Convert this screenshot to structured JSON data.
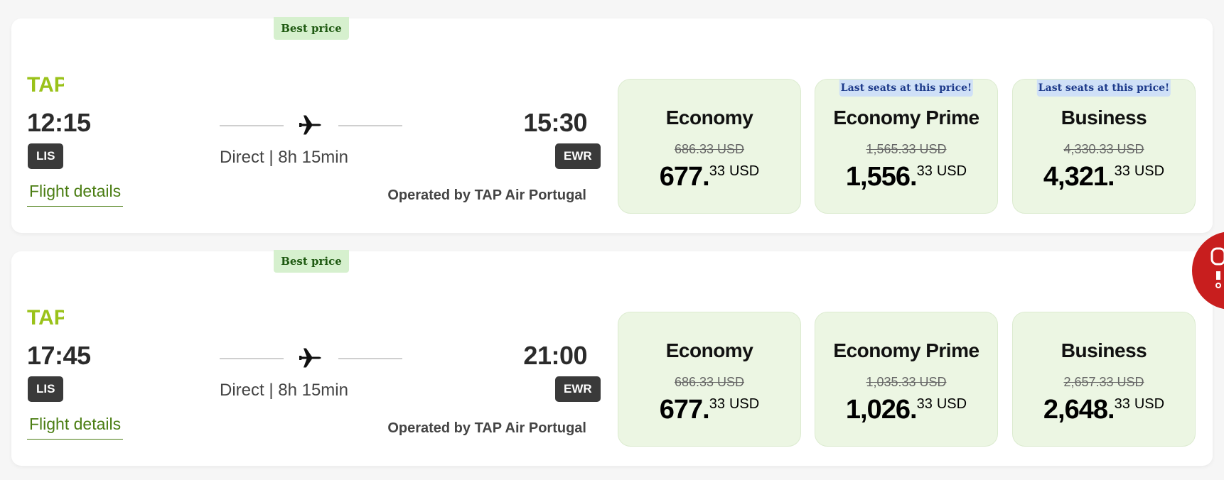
{
  "flights": [
    {
      "badge": "Best price",
      "airline": "TAP",
      "departure_time": "12:15",
      "departure_code": "LIS",
      "arrival_time": "15:30",
      "arrival_code": "EWR",
      "duration": "Direct | 8h 15min",
      "details_link": "Flight details",
      "operated_by": "Operated by TAP Air Portugal",
      "fares": [
        {
          "name": "Economy",
          "notice": "",
          "old_price": "686.33 USD",
          "price_main": "677.",
          "price_cents": "33",
          "currency": "USD"
        },
        {
          "name": "Economy Prime",
          "notice": "Last seats at this price!",
          "old_price": "1,565.33 USD",
          "price_main": "1,556.",
          "price_cents": "33",
          "currency": "USD"
        },
        {
          "name": "Business",
          "notice": "Last seats at this price!",
          "old_price": "4,330.33 USD",
          "price_main": "4,321.",
          "price_cents": "33",
          "currency": "USD"
        }
      ]
    },
    {
      "badge": "Best price",
      "airline": "TAP",
      "departure_time": "17:45",
      "departure_code": "LIS",
      "arrival_time": "21:00",
      "arrival_code": "EWR",
      "duration": "Direct | 8h 15min",
      "details_link": "Flight details",
      "operated_by": "Operated by TAP Air Portugal",
      "fares": [
        {
          "name": "Economy",
          "notice": "",
          "old_price": "686.33 USD",
          "price_main": "677.",
          "price_cents": "33",
          "currency": "USD"
        },
        {
          "name": "Economy Prime",
          "notice": "",
          "old_price": "1,035.33 USD",
          "price_main": "1,026.",
          "price_cents": "33",
          "currency": "USD"
        },
        {
          "name": "Business",
          "notice": "",
          "old_price": "2,657.33 USD",
          "price_main": "2,648.",
          "price_cents": "33",
          "currency": "USD"
        }
      ]
    }
  ],
  "colors": {
    "badge_bg": "#d6f0ce",
    "fare_bg": "#ecf6e3",
    "notice_bg": "#cfe0f7",
    "link": "#4a7d12",
    "chat": "#c81e1e"
  },
  "icons": {
    "plane": "plane-icon",
    "logo": "tap-logo",
    "chat": "chat-icon"
  }
}
